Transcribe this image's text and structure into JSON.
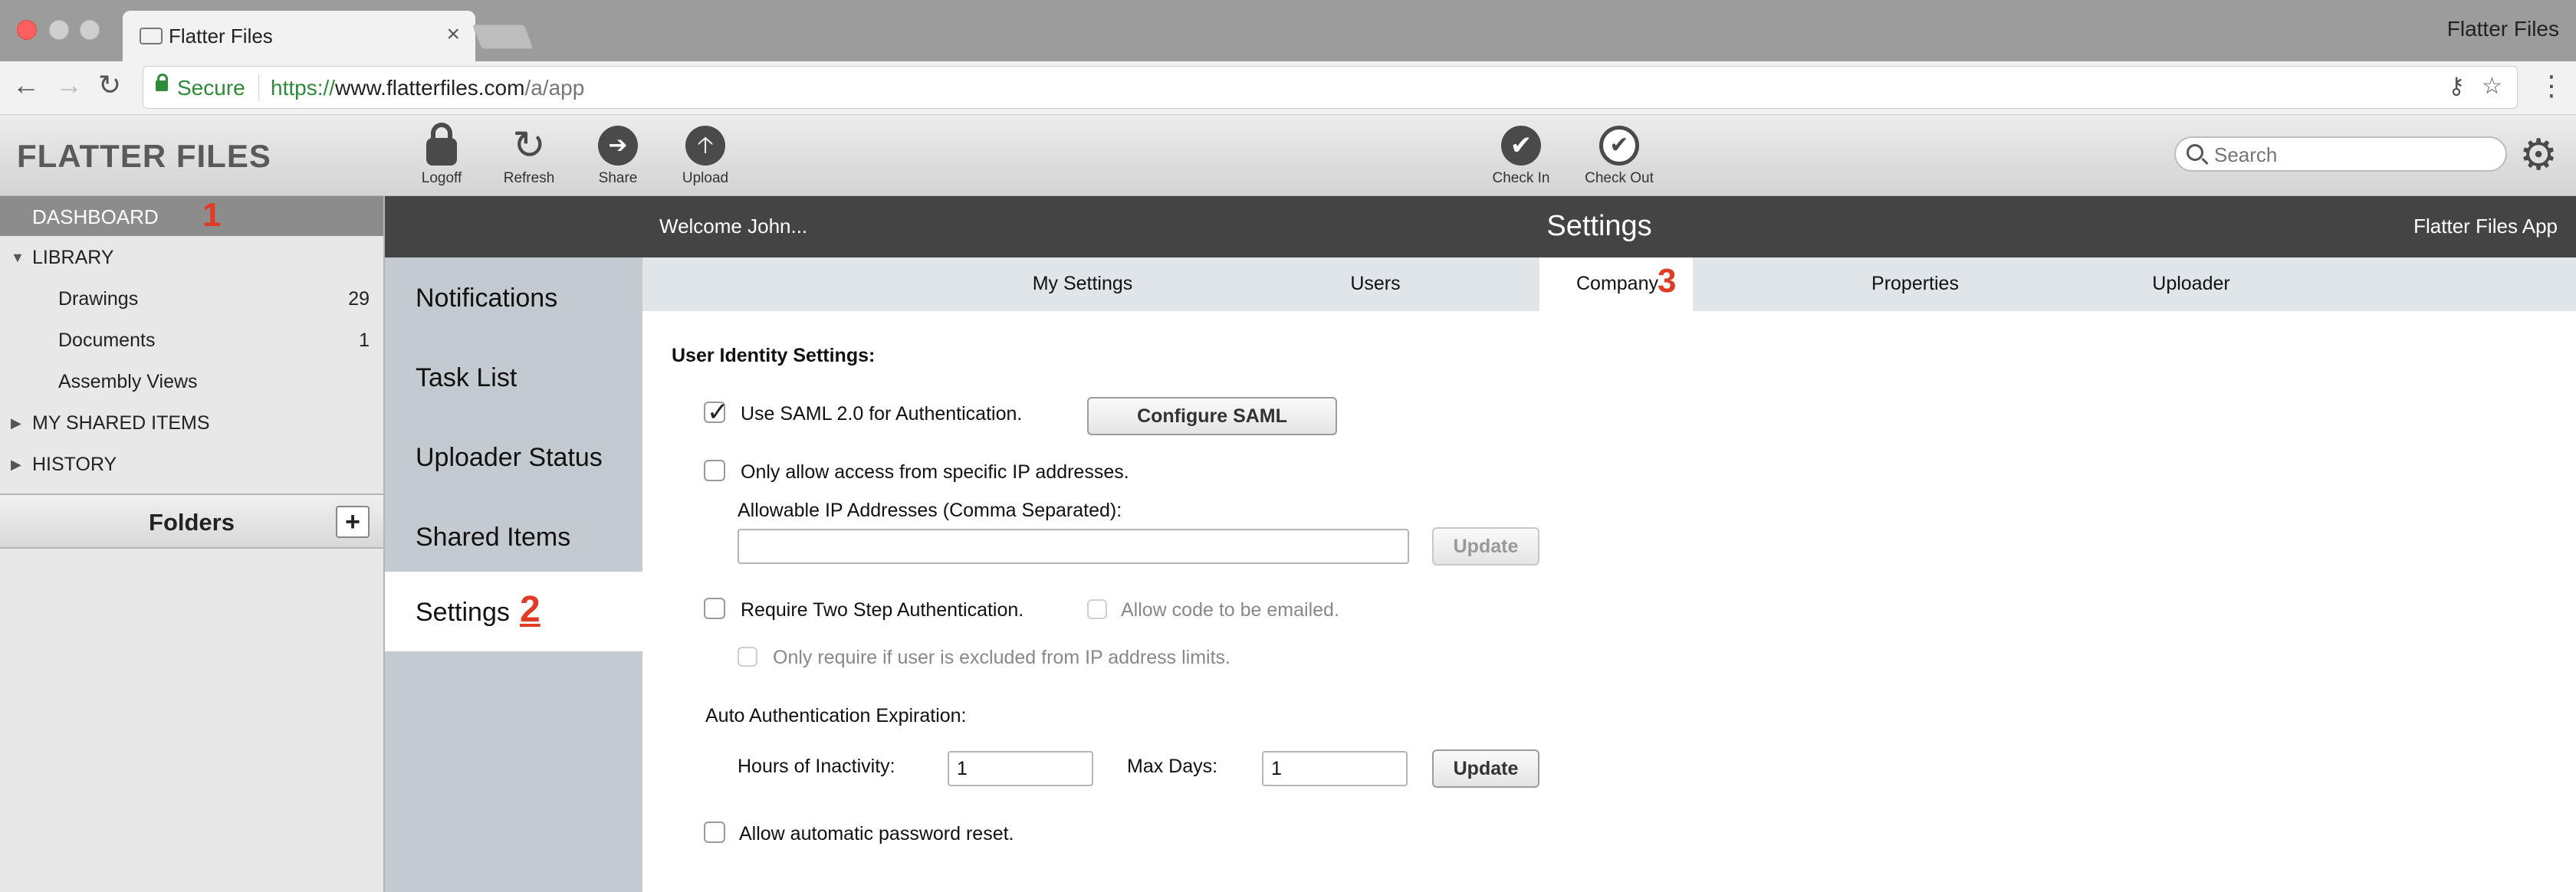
{
  "browser": {
    "tab_title": "Flatter Files",
    "profile_name": "Flatter Files",
    "secure_label": "Secure",
    "url_scheme": "https://",
    "url_host": "www.flatterfiles.com",
    "url_path": "/a/app"
  },
  "header": {
    "brand": "FLATTER FILES",
    "tools": {
      "logoff": "Logoff",
      "refresh": "Refresh",
      "share": "Share",
      "upload": "Upload",
      "check_in": "Check In",
      "check_out": "Check Out"
    },
    "search_placeholder": "Search"
  },
  "sidebar": {
    "dashboard": "DASHBOARD",
    "dashboard_marker": "1",
    "library": "LIBRARY",
    "items": [
      {
        "label": "Drawings",
        "count": "29"
      },
      {
        "label": "Documents",
        "count": "1"
      },
      {
        "label": "Assembly Views",
        "count": ""
      }
    ],
    "my_shared_items": "MY SHARED ITEMS",
    "history": "HISTORY",
    "folders": "Folders",
    "folders_add": "+"
  },
  "content_header": {
    "welcome": "Welcome John...",
    "title": "Settings",
    "app_link": "Flatter Files App"
  },
  "subnav": {
    "items": [
      "Notifications",
      "Task List",
      "Uploader Status",
      "Shared Items",
      "Settings"
    ],
    "settings_marker": "2"
  },
  "tabs": {
    "items": [
      "My Settings",
      "Users",
      "Company",
      "Properties",
      "Uploader"
    ],
    "company_marker": "3"
  },
  "main": {
    "section_title": "User Identity Settings:",
    "saml_label": "Use SAML 2.0 for Authentication.",
    "saml_checked": true,
    "configure_saml": "Configure SAML",
    "ip_label": "Only allow access from specific IP addresses.",
    "ip_field_label": "Allowable IP Addresses (Comma Separated):",
    "ip_value": "",
    "update": "Update",
    "two_step_label": "Require Two Step Authentication.",
    "email_code_label": "Allow code to be emailed.",
    "ip_excluded_label": "Only require if user is excluded from IP address limits.",
    "auto_auth_label": "Auto Authentication Expiration:",
    "hours_label": "Hours of Inactivity:",
    "hours_value": "1",
    "max_days_label": "Max Days:",
    "max_days_value": "1",
    "password_reset_label": "Allow automatic password reset."
  }
}
